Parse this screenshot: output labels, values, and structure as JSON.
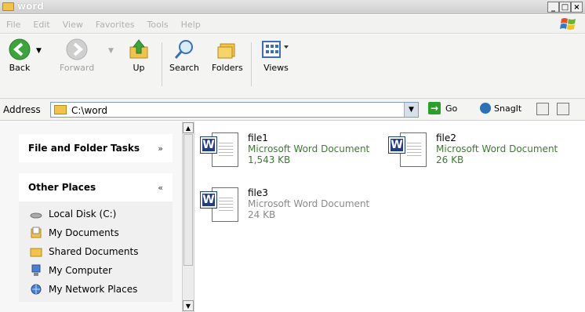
{
  "window": {
    "title": "word"
  },
  "menu": {
    "items": [
      "File",
      "Edit",
      "View",
      "Favorites",
      "Tools",
      "Help"
    ]
  },
  "toolbar": {
    "back": "Back",
    "forward": "Forward",
    "up": "Up",
    "search": "Search",
    "folders": "Folders",
    "views": "Views"
  },
  "address": {
    "label": "Address",
    "value": "C:\\word",
    "go": "Go",
    "snagit": "SnagIt"
  },
  "left_panel": {
    "tasks_title": "File and Folder Tasks",
    "places_title": "Other Places",
    "places": [
      "Local Disk (C:)",
      "My Documents",
      "Shared Documents",
      "My Computer",
      "My Network Places"
    ]
  },
  "files": [
    {
      "name": "file1",
      "type": "Microsoft Word Document",
      "size": "1,543 KB"
    },
    {
      "name": "file2",
      "type": "Microsoft Word Document",
      "size": "26 KB"
    },
    {
      "name": "file3",
      "type": "Microsoft Word Document",
      "size": "24 KB"
    }
  ],
  "colors": {
    "accent_green": "#3a7d2e",
    "word_blue": "#203d8a",
    "folder_yellow": "#f2c24a"
  }
}
